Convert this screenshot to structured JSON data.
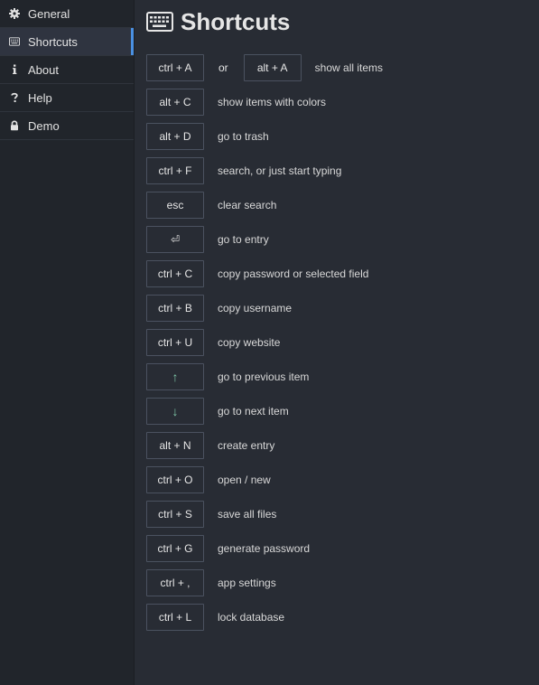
{
  "sidebar": {
    "items": [
      {
        "label": "General",
        "icon": "gear-icon"
      },
      {
        "label": "Shortcuts",
        "icon": "keyboard-icon"
      },
      {
        "label": "About",
        "icon": "info-icon"
      },
      {
        "label": "Help",
        "icon": "question-icon"
      },
      {
        "label": "Demo",
        "icon": "lock-icon"
      }
    ]
  },
  "page": {
    "title": "Shortcuts"
  },
  "shortcuts": {
    "show_all": {
      "key1": "ctrl + A",
      "or": "or",
      "key2": "alt + A",
      "desc": "show all items"
    },
    "rows": [
      {
        "key": "alt + C",
        "desc": "show items with colors"
      },
      {
        "key": "alt + D",
        "desc": "go to trash"
      },
      {
        "key": "ctrl + F",
        "desc": "search, or just start typing"
      },
      {
        "key": "esc",
        "desc": "clear search"
      },
      {
        "key": "⏎",
        "desc": "go to entry"
      },
      {
        "key": "ctrl + C",
        "desc": "copy password or selected field"
      },
      {
        "key": "ctrl + B",
        "desc": "copy username"
      },
      {
        "key": "ctrl + U",
        "desc": "copy website"
      },
      {
        "key": "↑",
        "desc": "go to previous item"
      },
      {
        "key": "↓",
        "desc": "go to next item"
      },
      {
        "key": "alt + N",
        "desc": "create entry"
      },
      {
        "key": "ctrl + O",
        "desc": "open / new"
      },
      {
        "key": "ctrl + S",
        "desc": "save all files"
      },
      {
        "key": "ctrl + G",
        "desc": "generate password"
      },
      {
        "key": "ctrl + ,",
        "desc": "app settings"
      },
      {
        "key": "ctrl + L",
        "desc": "lock database"
      }
    ]
  },
  "colors": {
    "background": "#282c34",
    "sidebar": "#21252b",
    "accent": "#4a90e2",
    "arrow": "#7dc4a6"
  }
}
